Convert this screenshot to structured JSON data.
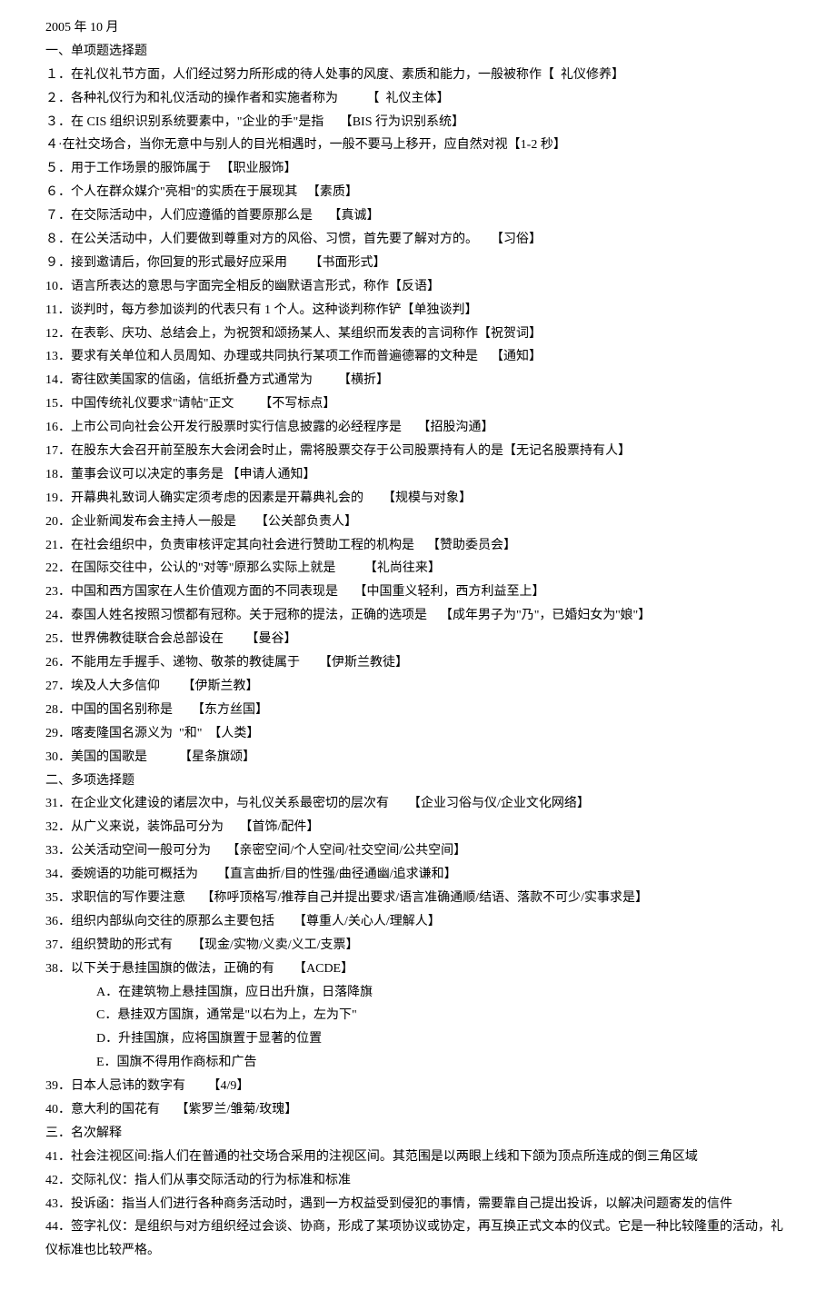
{
  "header": {
    "date": "2005 年 10 月",
    "section1_title": "一、单项题选择题"
  },
  "single_choice": [
    "１．在礼仪礼节方面，人们经过努力所形成的待人处事的风度、素质和能力，一般被称作【  礼仪修养】",
    "２．各种礼仪行为和礼仪活动的操作者和实施者称为         【  礼仪主体】",
    "３．在 CIS 组织识别系统要素中，\"企业的手\"是指     【BIS 行为识别系统】",
    "４·在社交场合，当你无意中与别人的目光相遇时，一般不要马上移开，应自然对视【1-2 秒】",
    "５．用于工作场景的服饰属于   【职业服饰】",
    "６．个人在群众媒介\"亮相\"的实质在于展现其   【素质】",
    "７．在交际活动中，人们应遵循的首要原那么是     【真诚】",
    "８．在公关活动中，人们要做到尊重对方的风俗、习惯，首先要了解对方的。    【习俗】",
    "９．接到邀请后，你回复的形式最好应采用       【书面形式】",
    "10．语言所表达的意思与字面完全相反的幽默语言形式，称作【反语】",
    "11．谈判时，每方参加谈判的代表只有 1 个人。这种谈判称作铲【单独谈判】",
    "12．在表彰、庆功、总结会上，为祝贺和颂扬某人、某组织而发表的言词称作【祝贺词】",
    "13．要求有关单位和人员周知、办理或共同执行某项工作而普遍德幂的文种是    【通知】",
    "14．寄往欧美国家的信函，信纸折叠方式通常为        【横折】",
    "15．中国传统礼仪要求\"请帖\"正文        【不写标点】",
    "16．上市公司向社会公开发行股票时实行信息披露的必经程序是     【招股沟通】",
    "17．在股东大会召开前至股东大会闭会时止，需将股票交存于公司股票持有人的是【无记名股票持有人】",
    "18．董事会议可以决定的事务是 【申请人通知】",
    "19．开幕典礼致词人确实定须考虑的因素是开幕典礼会的      【规模与对象】",
    "20．企业新闻发布会主持人一般是      【公关部负责人】",
    "21．在社会组织中，负责审核评定其向社会进行赞助工程的机构是    【赞助委员会】",
    "22．在国际交往中，公认的\"对等\"原那么实际上就是         【礼尚往来】",
    "23．中国和西方国家在人生价值观方面的不同表现是     【中国重义轻利，西方利益至上】",
    "24．泰国人姓名按照习惯都有冠称。关于冠称的提法，正确的选项是    【成年男子为\"乃\"，已婚妇女为''娘\"】",
    "25．世界佛教徒联合会总部设在       【曼谷】",
    "26．不能用左手握手、递物、敬茶的教徒属于      【伊斯兰教徒】",
    "27．埃及人大多信仰       【伊斯兰教】",
    "28．中国的国名别称是      【东方丝国】",
    "29．喀麦隆国名源义为  \"和\"  【人类】",
    "30．美国的国歌是          【星条旗颂】"
  ],
  "section2_title": "二、多项选择题",
  "multi_choice_pre": [
    "31．在企业文化建设的诸层次中，与礼仪关系最密切的层次有      【企业习俗与仪/企业文化网络】",
    "32．从广义来说，装饰品可分为     【首饰/配件】",
    "33．公关活动空间一般可分为     【亲密空间/个人空间/社交空间/公共空间】",
    "34．委婉语的功能可概括为      【直言曲折/目的性强/曲径通幽/追求谦和】",
    "35．求职信的写作要注意     【称呼顶格写/推荐自己并提出要求/语言准确通顺/结语、落款不可少/实事求是】",
    "36．组织内部纵向交往的原那么主要包括      【尊重人/关心人/理解人】",
    "37．组织赞助的形式有      【现金/实物/义卖/义工/支票】",
    "38．以下关于悬挂国旗的做法，正确的有      【ACDE】"
  ],
  "q38_options": [
    "A．在建筑物上悬挂国旗，应日出升旗，日落降旗",
    "C．悬挂双方国旗，通常是\"以右为上，左为下\"",
    "D．升挂国旗，应将国旗置于显著的位置",
    "E．国旗不得用作商标和广告"
  ],
  "multi_choice_post": [
    "39．日本人忌讳的数字有       【4/9】",
    "40．意大利的国花有     【紫罗兰/雏菊/玫瑰】"
  ],
  "section3_title": "三．名次解释",
  "explanations": [
    "41．社会注视区间:指人们在普通的社交场合采用的注视区间。其范围是以两眼上线和下颌为顶点所连成的倒三角区域",
    "42．交际礼仪：指人们从事交际活动的行为标准和标准",
    "43．投诉函：指当人们进行各种商务活动时，遇到一方权益受到侵犯的事情，需要靠自己提出投诉，以解决问题寄发的信件",
    "44．签字礼仪：是组织与对方组织经过会谈、协商，形成了某项协议或协定，再互换正式文本的仪式。它是一种比较隆重的活动，礼仪标准也比较严格。"
  ]
}
